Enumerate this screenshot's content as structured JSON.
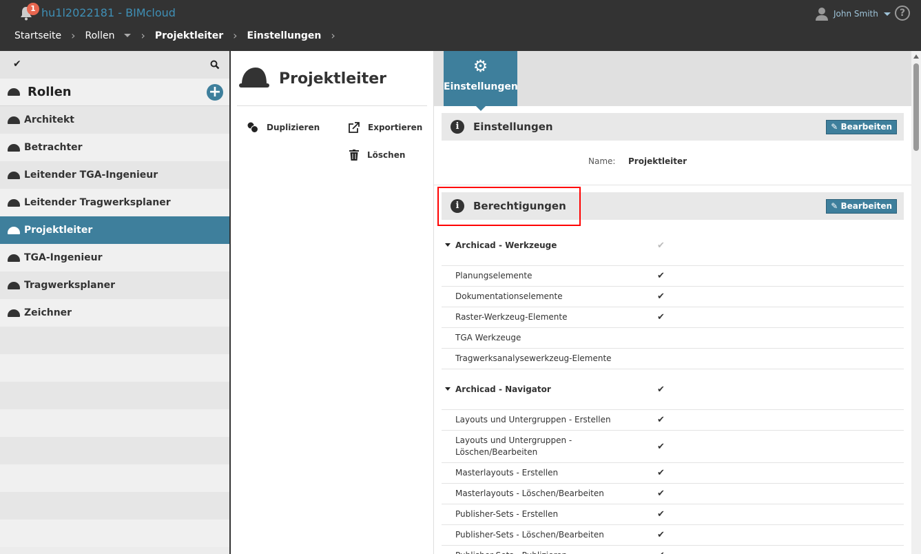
{
  "header": {
    "notification_count": "1",
    "app_title": "hu1l2022181 - BIMcloud",
    "user_name": "John Smith",
    "help": "?"
  },
  "breadcrumb": [
    "Startseite",
    "Rollen",
    "Projektleiter",
    "Einstellungen"
  ],
  "sidebar": {
    "title": "Rollen",
    "selected": "Projektleiter",
    "items": [
      "Architekt",
      "Betrachter",
      "Leitender TGA-Ingenieur",
      "Leitender Tragwerksplaner",
      "Projektleiter",
      "TGA-Ingenieur",
      "Tragwerksplaner",
      "Zeichner"
    ]
  },
  "middle": {
    "title": "Projektleiter",
    "actions": {
      "duplicate": "Duplizieren",
      "export": "Exportieren",
      "delete": "Löschen"
    }
  },
  "right": {
    "tab": "Einstellungen",
    "settings": {
      "title": "Einstellungen",
      "edit": "Bearbeiten",
      "name_label": "Name:",
      "name_value": "Projektleiter"
    },
    "permissions": {
      "title": "Berechtigungen",
      "edit": "Bearbeiten",
      "groups": [
        {
          "name": "Archicad - Werkzeuge",
          "check": "partial",
          "items": [
            {
              "label": "Planungselemente",
              "check": "yes"
            },
            {
              "label": "Dokumentationselemente",
              "check": "yes"
            },
            {
              "label": "Raster-Werkzeug-Elemente",
              "check": "yes"
            },
            {
              "label": "TGA Werkzeuge",
              "check": "no"
            },
            {
              "label": "Tragwerksanalysewerkzeug-Elemente",
              "check": "no"
            }
          ]
        },
        {
          "name": "Archicad - Navigator",
          "check": "yes",
          "items": [
            {
              "label": "Layouts und Untergruppen - Erstellen",
              "check": "yes"
            },
            {
              "label": "Layouts und Untergruppen - Löschen/Bearbeiten",
              "check": "yes"
            },
            {
              "label": "Masterlayouts - Erstellen",
              "check": "yes"
            },
            {
              "label": "Masterlayouts - Löschen/Bearbeiten",
              "check": "yes"
            },
            {
              "label": "Publisher-Sets - Erstellen",
              "check": "yes"
            },
            {
              "label": "Publisher-Sets - Löschen/Bearbeiten",
              "check": "yes"
            },
            {
              "label": "Publisher-Sets - Publizieren",
              "check": "yes"
            }
          ]
        }
      ]
    }
  }
}
